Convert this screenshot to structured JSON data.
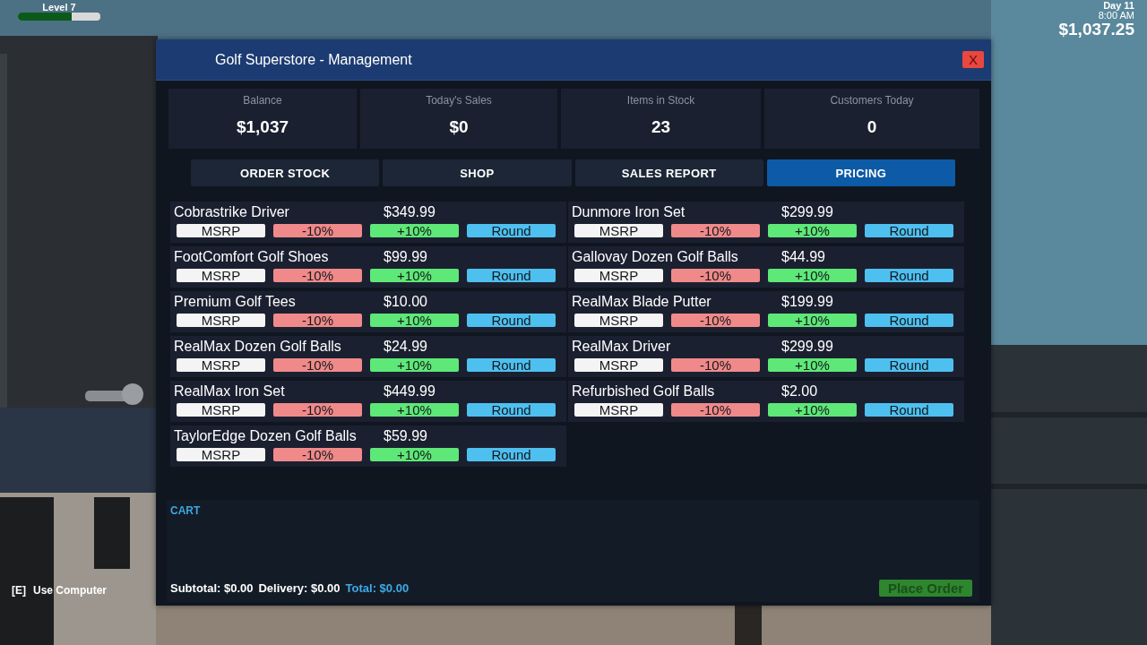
{
  "hud": {
    "level_label": "Level 7",
    "xp_bar": {
      "level": 0.65
    },
    "day": "Day 11",
    "time": "8:00 AM",
    "money": "$1,037.25",
    "hint": {
      "key": "[E]",
      "action": "Use Computer"
    }
  },
  "window": {
    "title": "Golf Superstore - Management",
    "close_label": "X"
  },
  "stats": [
    {
      "label": "Balance",
      "value": "$1,037"
    },
    {
      "label": "Today's Sales",
      "value": "$0"
    },
    {
      "label": "Items in Stock",
      "value": "23"
    },
    {
      "label": "Customers Today",
      "value": "0"
    }
  ],
  "tabs": [
    {
      "label": "ORDER STOCK",
      "selected": false
    },
    {
      "label": "SHOP",
      "selected": false
    },
    {
      "label": "SALES REPORT",
      "selected": false
    },
    {
      "label": "PRICING",
      "selected": true
    }
  ],
  "products": [
    {
      "name": "Cobrastrike Driver",
      "price": "$349.99",
      "actions": [
        {
          "kind": "msrp",
          "label": "MSRP"
        },
        {
          "kind": "decrease",
          "label": "-10%"
        },
        {
          "kind": "increase",
          "label": "+10%"
        },
        {
          "kind": "round",
          "label": "Round"
        }
      ]
    },
    {
      "name": "Dunmore Iron Set",
      "price": "$299.99",
      "actions": [
        {
          "kind": "msrp",
          "label": "MSRP"
        },
        {
          "kind": "decrease",
          "label": "-10%"
        },
        {
          "kind": "increase",
          "label": "+10%"
        },
        {
          "kind": "round",
          "label": "Round"
        }
      ]
    },
    {
      "name": "FootComfort Golf Shoes",
      "price": "$99.99",
      "actions": [
        {
          "kind": "msrp",
          "label": "MSRP"
        },
        {
          "kind": "decrease",
          "label": "-10%"
        },
        {
          "kind": "increase",
          "label": "+10%"
        },
        {
          "kind": "round",
          "label": "Round"
        }
      ]
    },
    {
      "name": "Gallovay Dozen Golf Balls",
      "price": "$44.99",
      "actions": [
        {
          "kind": "msrp",
          "label": "MSRP"
        },
        {
          "kind": "decrease",
          "label": "-10%"
        },
        {
          "kind": "increase",
          "label": "+10%"
        },
        {
          "kind": "round",
          "label": "Round"
        }
      ]
    },
    {
      "name": "Premium Golf Tees",
      "price": "$10.00",
      "actions": [
        {
          "kind": "msrp",
          "label": "MSRP"
        },
        {
          "kind": "decrease",
          "label": "-10%"
        },
        {
          "kind": "increase",
          "label": "+10%"
        },
        {
          "kind": "round",
          "label": "Round"
        }
      ]
    },
    {
      "name": "RealMax Blade Putter",
      "price": "$199.99",
      "actions": [
        {
          "kind": "msrp",
          "label": "MSRP"
        },
        {
          "kind": "decrease",
          "label": "-10%"
        },
        {
          "kind": "increase",
          "label": "+10%"
        },
        {
          "kind": "round",
          "label": "Round"
        }
      ]
    },
    {
      "name": "RealMax Dozen Golf Balls",
      "price": "$24.99",
      "actions": [
        {
          "kind": "msrp",
          "label": "MSRP"
        },
        {
          "kind": "decrease",
          "label": "-10%"
        },
        {
          "kind": "increase",
          "label": "+10%"
        },
        {
          "kind": "round",
          "label": "Round"
        }
      ]
    },
    {
      "name": "RealMax Driver",
      "price": "$299.99",
      "actions": [
        {
          "kind": "msrp",
          "label": "MSRP"
        },
        {
          "kind": "decrease",
          "label": "-10%"
        },
        {
          "kind": "increase",
          "label": "+10%"
        },
        {
          "kind": "round",
          "label": "Round"
        }
      ]
    },
    {
      "name": "RealMax Iron Set",
      "price": "$449.99",
      "actions": [
        {
          "kind": "msrp",
          "label": "MSRP"
        },
        {
          "kind": "decrease",
          "label": "-10%"
        },
        {
          "kind": "increase",
          "label": "+10%"
        },
        {
          "kind": "round",
          "label": "Round"
        }
      ]
    },
    {
      "name": "Refurbished Golf Balls",
      "price": "$2.00",
      "actions": [
        {
          "kind": "msrp",
          "label": "MSRP"
        },
        {
          "kind": "decrease",
          "label": "-10%"
        },
        {
          "kind": "increase",
          "label": "+10%"
        },
        {
          "kind": "round",
          "label": "Round"
        }
      ]
    },
    {
      "name": "TaylorEdge Dozen Golf Balls",
      "price": "$59.99",
      "actions": [
        {
          "kind": "msrp",
          "label": "MSRP"
        },
        {
          "kind": "decrease",
          "label": "-10%"
        },
        {
          "kind": "increase",
          "label": "+10%"
        },
        {
          "kind": "round",
          "label": "Round"
        }
      ]
    }
  ],
  "cart": {
    "title": "CART",
    "subtotal": "Subtotal: $0.00",
    "delivery": "Delivery: $0.00",
    "total": "Total: $0.00",
    "place_order": {
      "label": "Place Order",
      "disabled": true
    }
  }
}
